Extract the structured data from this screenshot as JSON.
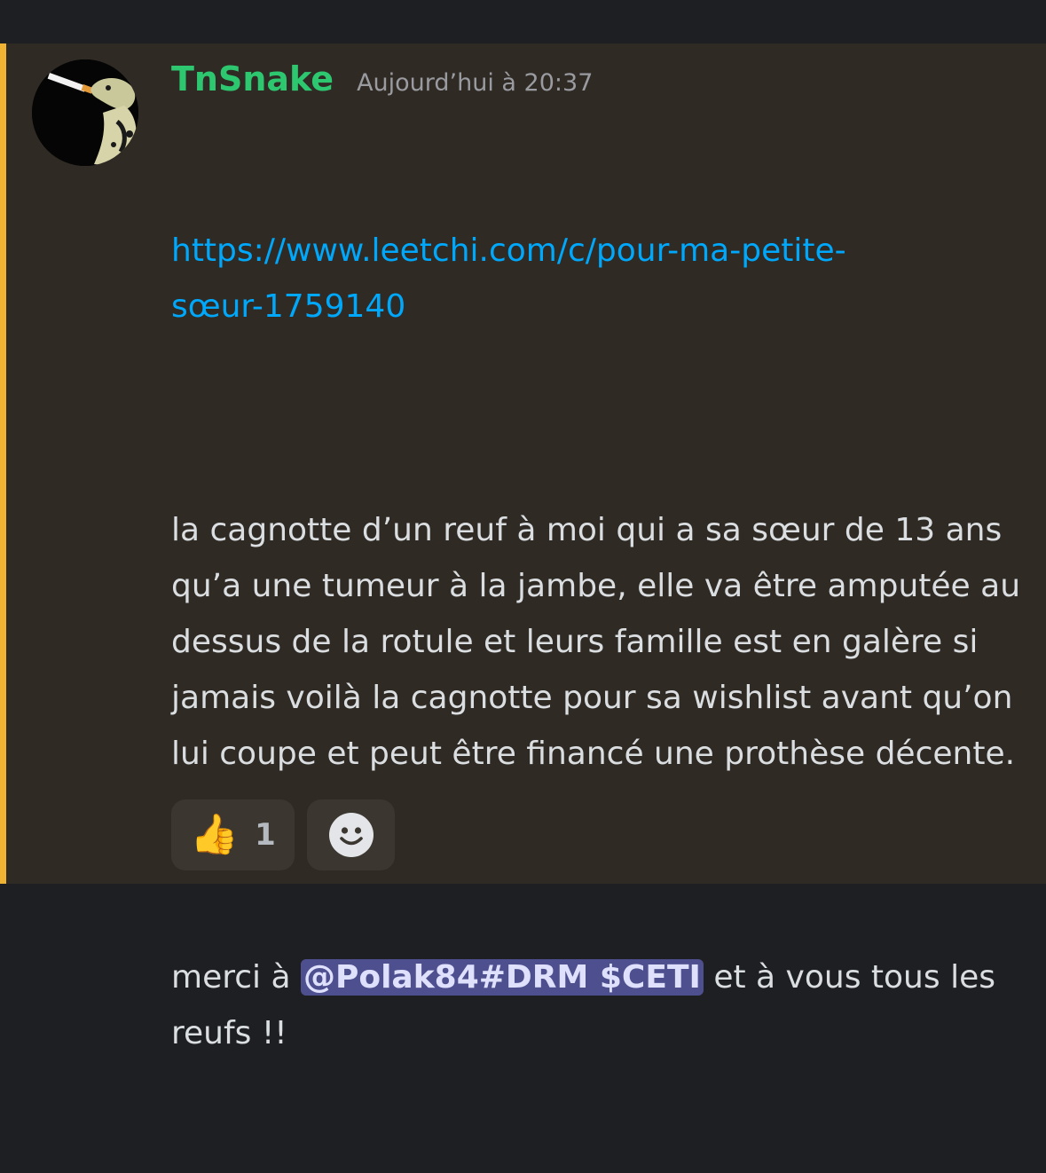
{
  "message": {
    "author": "TnSnake",
    "timestamp": "Aujourd’hui à 20:37",
    "link_line1": "https://www.leetchi.com/c/pour-ma-petite-",
    "link_line2": "sœur-1759140",
    "paragraph1": "la cagnotte d’un reuf à moi qui a sa sœur de 13 ans qu’a une tumeur à la jambe, elle va être amputée au dessus de la rotule et leurs famille est en galère si jamais voilà la cagnotte pour sa wishlist avant qu’on lui coupe et peut être financé une prothèse décente.",
    "paragraph2_before": "merci à ",
    "mention": "@Polak84#DRM $CETI",
    "paragraph2_after": " et à vous tous les reufs !!"
  },
  "reactions": [
    {
      "emoji": "👍",
      "icon": "thumbs-up-icon",
      "count": "1"
    },
    {
      "icon": "add-reaction-icon"
    }
  ],
  "colors": {
    "username": "#2dc770",
    "link": "#00a8fc",
    "mention_bg": "#4e4f8f",
    "highlight_stripe": "#f0b232",
    "message_bg": "#2f2a24"
  }
}
